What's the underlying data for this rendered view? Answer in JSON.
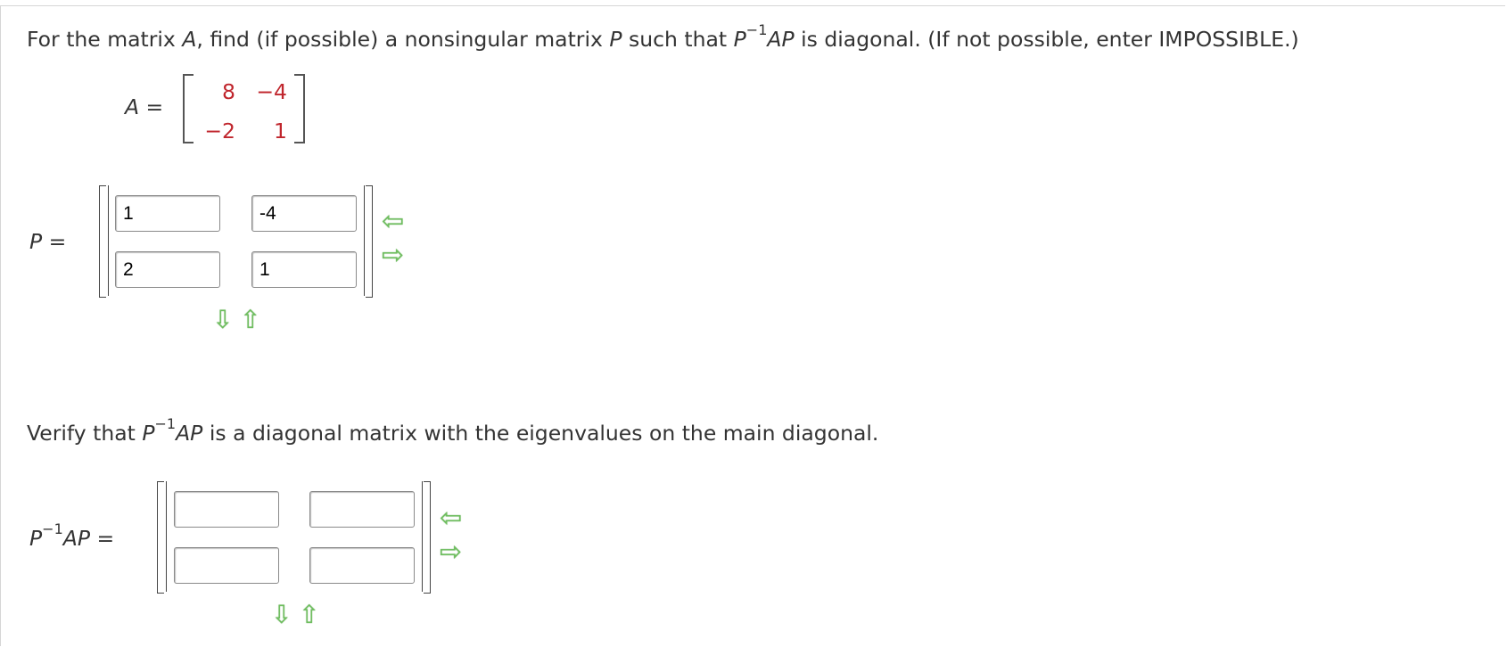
{
  "question": {
    "part1": "For the matrix ",
    "A": "A",
    "part2": ", find (if possible) a nonsingular matrix ",
    "P": "P",
    "part3": " such that ",
    "P2": "P",
    "sup": "−1",
    "AP": "AP",
    "part4": " is diagonal. (If not possible, enter IMPOSSIBLE.)"
  },
  "matrix_A": {
    "label": "A",
    "equals": " =",
    "rows": [
      [
        "8",
        "−4"
      ],
      [
        "−2",
        "1"
      ]
    ]
  },
  "matrix_P": {
    "label": "P",
    "equals": " =",
    "values": [
      [
        "1",
        "-4"
      ],
      [
        "2",
        "1"
      ]
    ]
  },
  "verify": {
    "part1": "Verify that ",
    "P": "P",
    "sup": "−1",
    "AP": "AP",
    "part2": " is a diagonal matrix with the eigenvalues on the main diagonal."
  },
  "matrix_D": {
    "label_P": "P",
    "sup": "−1",
    "label_AP": "AP",
    "equals": " =",
    "values": [
      [
        "",
        ""
      ],
      [
        "",
        ""
      ]
    ]
  },
  "controls": {
    "remove_column": "⇦",
    "add_column": "⇨",
    "add_row": "⇩",
    "remove_row": "⇧"
  },
  "colors": {
    "matrix_values": "#c0262d",
    "arrows": "#6fbf5f"
  }
}
